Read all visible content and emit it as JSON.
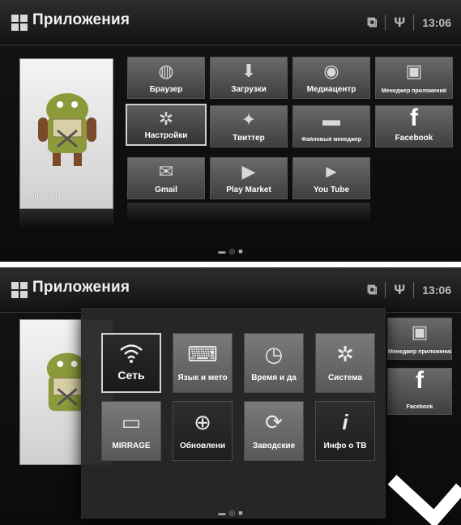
{
  "screen1": {
    "title": "Приложения",
    "time": "13:06",
    "featured_label": "ANDROID",
    "apps": [
      {
        "label": "Браузер",
        "icon": "globe-icon"
      },
      {
        "label": "Загрузки",
        "icon": "download-icon"
      },
      {
        "label": "Медиацентр",
        "icon": "media-center-icon"
      },
      {
        "label": "Менеджер приложений",
        "icon": "app-manager-icon"
      },
      {
        "label": "Настройки",
        "icon": "gear-icon"
      },
      {
        "label": "Твиттер",
        "icon": "twitter-icon"
      },
      {
        "label": "Файловый менеджер",
        "icon": "folder-icon"
      },
      {
        "label": "Facebook",
        "icon": "facebook-icon"
      },
      {
        "label": "Gmail",
        "icon": "gmail-icon"
      },
      {
        "label": "Play Market",
        "icon": "play-market-icon"
      },
      {
        "label": "You Tube",
        "icon": "youtube-icon"
      }
    ]
  },
  "screen2": {
    "title": "Приложения",
    "time": "13:06",
    "settings": [
      {
        "label": "Сеть",
        "icon": "wifi-icon"
      },
      {
        "label": "Язык и мето",
        "icon": "keyboard-icon"
      },
      {
        "label": "Время и да",
        "icon": "clock-icon"
      },
      {
        "label": "Система",
        "icon": "gear-icon"
      },
      {
        "label": "MIRRAGE",
        "icon": "mirror-screen-icon"
      },
      {
        "label": "Обновлени",
        "icon": "update-icon"
      },
      {
        "label": "Заводские",
        "icon": "reset-icon"
      },
      {
        "label": "Инфо о ТВ",
        "icon": "info-icon"
      }
    ],
    "bg_apps": [
      {
        "label": "Менеджер приложений"
      },
      {
        "label": "Facebook"
      }
    ]
  }
}
